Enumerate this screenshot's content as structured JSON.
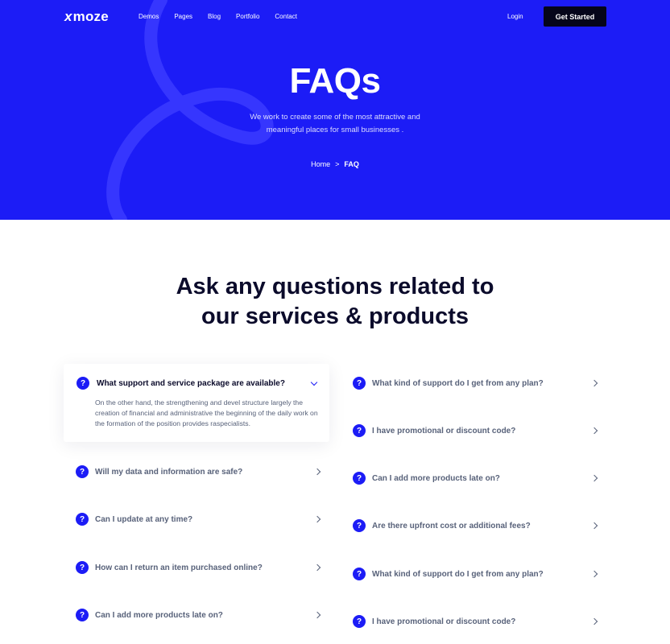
{
  "brand": {
    "logo_mark": "x",
    "logo_text": "moze"
  },
  "nav": {
    "items": [
      {
        "label": "Demos"
      },
      {
        "label": "Pages"
      },
      {
        "label": "Blog"
      },
      {
        "label": "Portfolio"
      },
      {
        "label": "Contact"
      }
    ],
    "login_label": "Login",
    "cta_label": "Get Started"
  },
  "hero": {
    "title": "FAQs",
    "subtitle": "We work to create some of the most attractive and meaningful places for small businesses .",
    "breadcrumb": {
      "home": "Home",
      "separator": ">",
      "current": "FAQ"
    }
  },
  "section": {
    "title": "Ask any questions related to our services & products"
  },
  "faq": {
    "open_item": {
      "question": "What support and service package are available?",
      "answer": "On the other hand, the strengthening and devel structure largely the creation of financial and administrative the beginning of the daily work on the formation of the position provides raspecialists."
    },
    "left": [
      {
        "question": "Will my data and information are safe?"
      },
      {
        "question": "Can I update at any time?"
      },
      {
        "question": "How can I return an item purchased online?"
      },
      {
        "question": "Can I add more products late on?"
      }
    ],
    "right": [
      {
        "question": "What kind of support do I get from any plan?"
      },
      {
        "question": "I have promotional or discount code?"
      },
      {
        "question": "Can I add more products late on?"
      },
      {
        "question": "Are there upfront cost or additional fees?"
      },
      {
        "question": "What kind of support do I get from any plan?"
      },
      {
        "question": "I have promotional or discount code?"
      }
    ],
    "icon_glyph": "?"
  },
  "colors": {
    "brand_blue": "#1c1cf6",
    "dark": "#05051a",
    "muted_text": "#58627a"
  }
}
